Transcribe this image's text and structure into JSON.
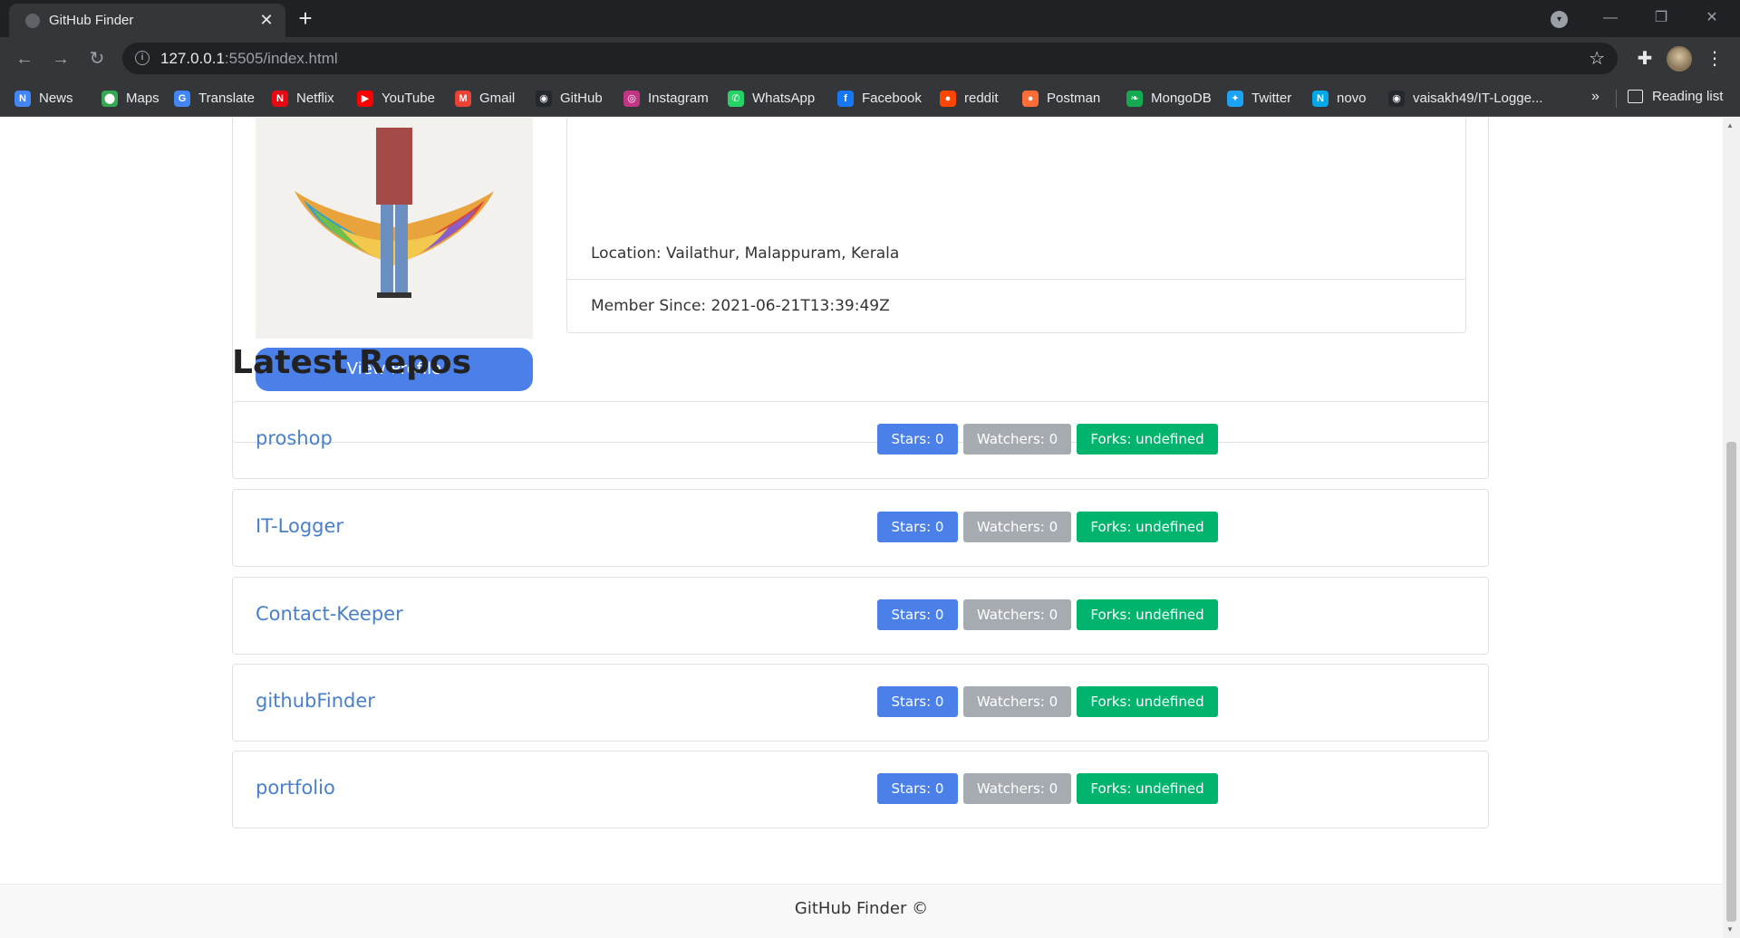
{
  "browser": {
    "tab_title": "GitHub Finder",
    "tab_close": "✕",
    "new_tab": "+",
    "url_host": "127.0.0.1",
    "url_path": ":5505/index.html",
    "bookmarks": [
      {
        "label": "News",
        "icon": "google-news-icon",
        "color": "#4285f4",
        "glyph": "N"
      },
      {
        "label": "Maps",
        "icon": "maps-pin-icon",
        "color": "#34a853",
        "glyph": "⬤"
      },
      {
        "label": "Translate",
        "icon": "translate-icon",
        "color": "#4285f4",
        "glyph": "G"
      },
      {
        "label": "Netflix",
        "icon": "netflix-icon",
        "color": "#e50914",
        "glyph": "N"
      },
      {
        "label": "YouTube",
        "icon": "youtube-icon",
        "color": "#ff0000",
        "glyph": "▶"
      },
      {
        "label": "Gmail",
        "icon": "gmail-icon",
        "color": "#ea4335",
        "glyph": "M"
      },
      {
        "label": "GitHub",
        "icon": "github-icon",
        "color": "#24292e",
        "glyph": "◉"
      },
      {
        "label": "Instagram",
        "icon": "instagram-icon",
        "color": "#c13584",
        "glyph": "◎"
      },
      {
        "label": "WhatsApp",
        "icon": "whatsapp-icon",
        "color": "#25d366",
        "glyph": "✆"
      },
      {
        "label": "Facebook",
        "icon": "facebook-icon",
        "color": "#1877f2",
        "glyph": "f"
      },
      {
        "label": "reddit",
        "icon": "reddit-icon",
        "color": "#ff4500",
        "glyph": "●"
      },
      {
        "label": "Postman",
        "icon": "postman-icon",
        "color": "#ff6c37",
        "glyph": "●"
      },
      {
        "label": "MongoDB",
        "icon": "mongodb-leaf-icon",
        "color": "#13aa52",
        "glyph": "❧"
      },
      {
        "label": "Twitter",
        "icon": "twitter-icon",
        "color": "#1da1f2",
        "glyph": "✦"
      },
      {
        "label": "novo",
        "icon": "novo-icon",
        "color": "#00a8e8",
        "glyph": "N"
      },
      {
        "label": "vaisakh49/IT-Logge...",
        "icon": "github-icon",
        "color": "#24292e",
        "glyph": "◉"
      }
    ],
    "bookmarks_more": "»",
    "reading_list": "Reading list"
  },
  "profile": {
    "location": "Location: Vailathur, Malappuram, Kerala",
    "member_since": "Member Since: 2021-06-21T13:39:49Z",
    "view_profile_label": "View Profile"
  },
  "repos": {
    "heading": "Latest Repos",
    "items": [
      {
        "name": "proshop",
        "stars": "Stars: 0",
        "watchers": "Watchers: 0",
        "forks": "Forks: undefined"
      },
      {
        "name": "IT-Logger",
        "stars": "Stars: 0",
        "watchers": "Watchers: 0",
        "forks": "Forks: undefined"
      },
      {
        "name": "Contact-Keeper",
        "stars": "Stars: 0",
        "watchers": "Watchers: 0",
        "forks": "Forks: undefined"
      },
      {
        "name": "githubFinder",
        "stars": "Stars: 0",
        "watchers": "Watchers: 0",
        "forks": "Forks: undefined"
      },
      {
        "name": "portfolio",
        "stars": "Stars: 0",
        "watchers": "Watchers: 0",
        "forks": "Forks: undefined"
      }
    ]
  },
  "footer": {
    "text": "GitHub Finder ©"
  },
  "colors": {
    "primary": "#4a80e8",
    "light": "#a6abb2",
    "success": "#00b46e",
    "link": "#4a80c8"
  }
}
